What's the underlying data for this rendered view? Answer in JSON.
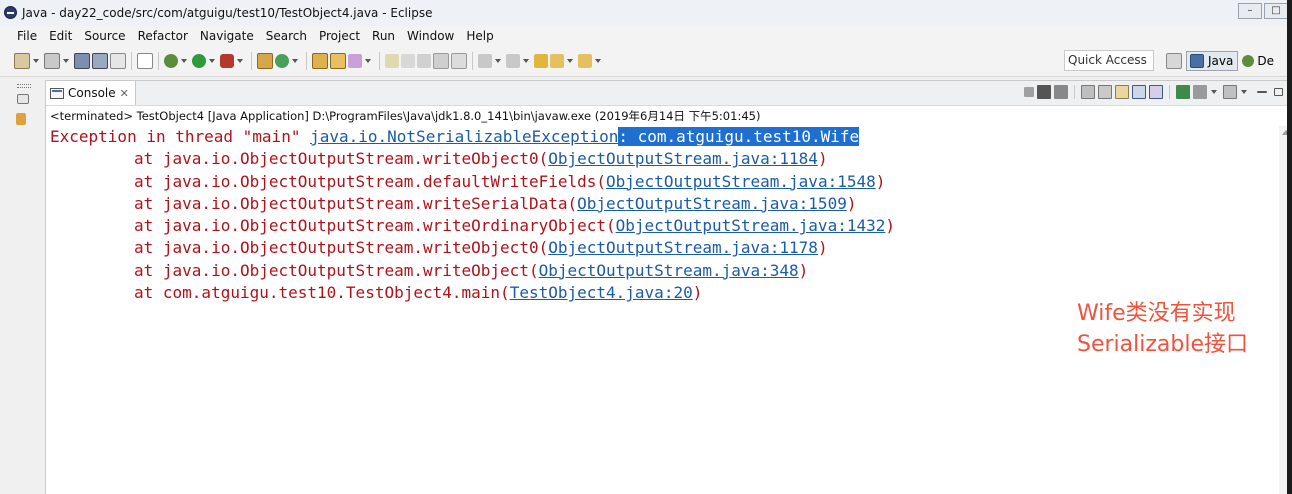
{
  "window": {
    "title": "Java - day22_code/src/com/atguigu/test10/TestObject4.java - Eclipse",
    "controls": [
      "–",
      "□"
    ]
  },
  "menu": [
    "File",
    "Edit",
    "Source",
    "Refactor",
    "Navigate",
    "Search",
    "Project",
    "Run",
    "Window",
    "Help"
  ],
  "toolbar": {
    "quick_access": "Quick Access",
    "perspective_java": "Java",
    "perspective_debug": "De"
  },
  "console": {
    "tab_label": "Console",
    "tab_close": "✕",
    "status": "<terminated> TestObject4 [Java Application] D:\\ProgramFiles\\Java\\jdk1.8.0_141\\bin\\javaw.exe (2019年6月14日 下午5:01:45)",
    "exception": {
      "prefix": "Exception in thread \"main\" ",
      "type": "java.io.NotSerializableException",
      "colon": ":",
      "message": " com.atguigu.test10.Wife"
    },
    "frames": [
      {
        "method": "at java.io.ObjectOutputStream.writeObject0(",
        "link": "ObjectOutputStream.java:1184",
        "close": ")"
      },
      {
        "method": "at java.io.ObjectOutputStream.defaultWriteFields(",
        "link": "ObjectOutputStream.java:1548",
        "close": ")"
      },
      {
        "method": "at java.io.ObjectOutputStream.writeSerialData(",
        "link": "ObjectOutputStream.java:1509",
        "close": ")"
      },
      {
        "method": "at java.io.ObjectOutputStream.writeOrdinaryObject(",
        "link": "ObjectOutputStream.java:1432",
        "close": ")"
      },
      {
        "method": "at java.io.ObjectOutputStream.writeObject0(",
        "link": "ObjectOutputStream.java:1178",
        "close": ")"
      },
      {
        "method": "at java.io.ObjectOutputStream.writeObject(",
        "link": "ObjectOutputStream.java:348",
        "close": ")"
      },
      {
        "method": "at com.atguigu.test10.TestObject4.main(",
        "link": "TestObject4.java:20",
        "close": ")"
      }
    ]
  },
  "annotation": {
    "line1": "Wife类没有实现",
    "line2": "Serializable接口"
  },
  "colors": {
    "error_text": "#b1121a",
    "link": "#1a5ca8",
    "selection": "#1f6fd0",
    "annotation": "#f1523c"
  }
}
